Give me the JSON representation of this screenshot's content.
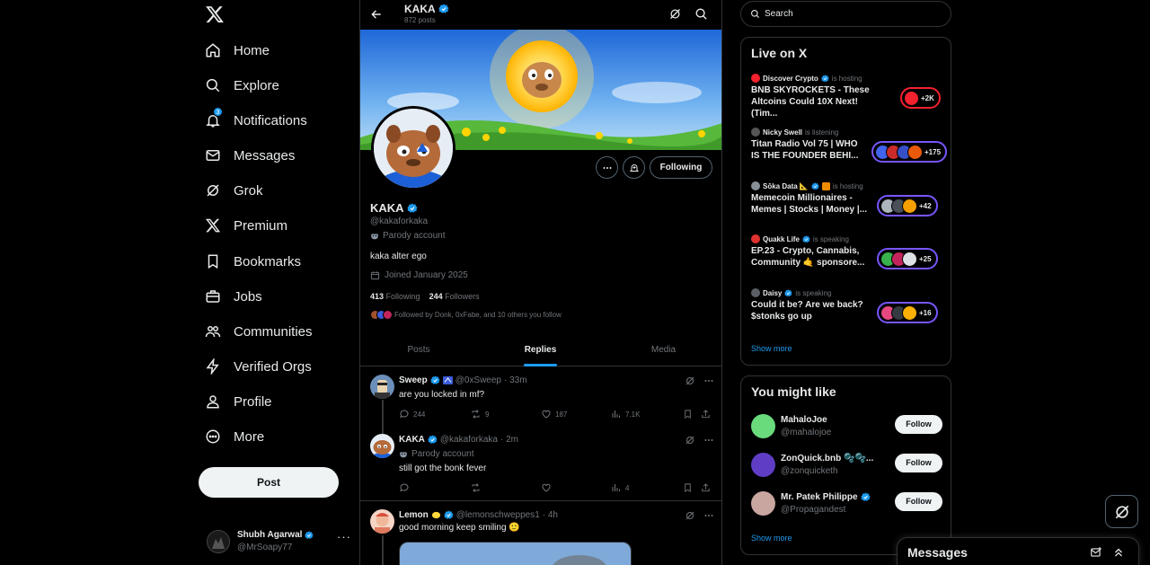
{
  "nav": {
    "items": [
      {
        "label": "Home",
        "icon": "home-icon"
      },
      {
        "label": "Explore",
        "icon": "search-icon"
      },
      {
        "label": "Notifications",
        "icon": "bell-icon",
        "badge": "3"
      },
      {
        "label": "Messages",
        "icon": "envelope-icon"
      },
      {
        "label": "Grok",
        "icon": "grok-icon"
      },
      {
        "label": "Premium",
        "icon": "x-logo-icon"
      },
      {
        "label": "Bookmarks",
        "icon": "bookmark-icon"
      },
      {
        "label": "Jobs",
        "icon": "briefcase-icon"
      },
      {
        "label": "Communities",
        "icon": "people-icon"
      },
      {
        "label": "Verified Orgs",
        "icon": "lightning-icon"
      },
      {
        "label": "Profile",
        "icon": "person-icon"
      },
      {
        "label": "More",
        "icon": "more-circle-icon"
      }
    ],
    "post_label": "Post",
    "account": {
      "name": "Shubh Agarwal",
      "handle": "@MrSoapy77"
    }
  },
  "topbar": {
    "title": "KAKA",
    "posts_count": "872 posts"
  },
  "profile": {
    "name": "KAKA",
    "handle": "@kakaforkaka",
    "parody": "Parody account",
    "bio": "kaka alter ego",
    "joined": "Joined January 2025",
    "following_count": "413",
    "following_label": "Following",
    "followers_count": "244",
    "followers_label": "Followers",
    "followed_by": "Followed by Donk, 0xFabe, and 10 others you follow",
    "following_button": "Following"
  },
  "tabs": [
    {
      "label": "Posts"
    },
    {
      "label": "Replies",
      "active": true
    },
    {
      "label": "Media"
    }
  ],
  "tweets": [
    {
      "name": "Sweep",
      "handle": "@0xSweep",
      "time": "· 33m",
      "text": "are you locked in mf?",
      "replies": "244",
      "reposts": "9",
      "likes": "187",
      "views": "7.1K"
    },
    {
      "name": "KAKA",
      "handle": "@kakaforkaka",
      "time": "· 2m",
      "parody": "Parody account",
      "text": "still got the bonk fever",
      "replies": "",
      "reposts": "",
      "likes": "",
      "views": "4"
    },
    {
      "name": "Lemon",
      "handle": "@lemonschweppes1",
      "time": "· 4h",
      "text": "good morning keep smiling 🙂"
    }
  ],
  "search": {
    "placeholder": "Search"
  },
  "live": {
    "title": "Live on X",
    "items": [
      {
        "host": "Discover Crypto",
        "status": "is hosting",
        "title": "BNB SKYROCKETS - These\nAltcoins Could 10X Next! (Tim...",
        "count": "+2K",
        "color": "#f4212e"
      },
      {
        "host": "Nicky Swell",
        "status": "is listening",
        "title": "Titan Radio Vol 75 | WHO\nIS THE FOUNDER BEHI...",
        "count": "+175",
        "color": "#7856ff"
      },
      {
        "host": "Sōka Data 📐",
        "status": "is hosting",
        "title": "Memecoin Millionaires -\nMemes | Stocks | Money |...",
        "count": "+42",
        "color": "#7856ff"
      },
      {
        "host": "Quakk Life",
        "status": "is speaking",
        "title": "EP.23 - Crypto, Cannabis,\nCommunity 🤙 sponsore...",
        "count": "+25",
        "color": "#7856ff"
      },
      {
        "host": "Daisy",
        "status": "is speaking",
        "title": "Could it be? Are we back?\n$stonks go up",
        "count": "+16",
        "color": "#7856ff"
      }
    ],
    "show_more": "Show more"
  },
  "who_to_follow": {
    "title": "You might like",
    "items": [
      {
        "name": "MahaloJoe",
        "handle": "@mahalojoe",
        "verified": false
      },
      {
        "name": "ZonQuick.bnb 🫧🫧...",
        "handle": "@zonquicketh",
        "verified": false
      },
      {
        "name": "Mr. Patek Philippe",
        "handle": "@Propagandest",
        "verified": true
      }
    ],
    "follow_label": "Follow",
    "show_more": "Show more"
  },
  "messages_drawer": {
    "title": "Messages"
  },
  "colors": {
    "accent": "#1d9bf0",
    "background": "#000000",
    "border": "#2f3336",
    "muted": "#71767b"
  }
}
